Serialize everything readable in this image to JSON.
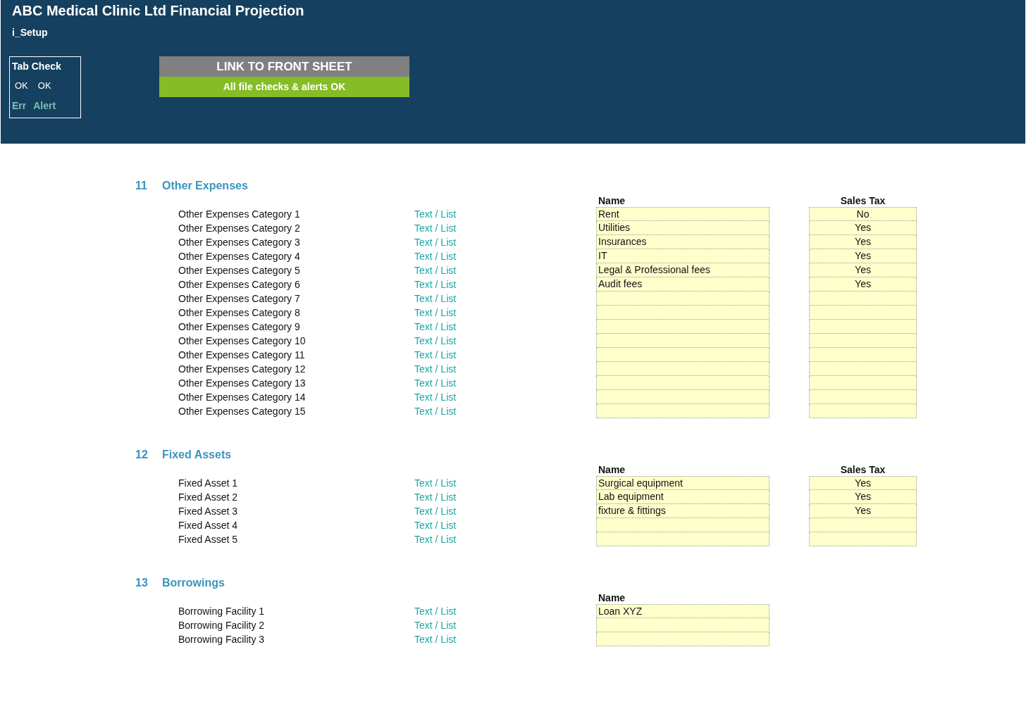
{
  "header": {
    "title": "ABC Medical Clinic Ltd Financial Projection",
    "subtitle": "i_Setup"
  },
  "tab_check": {
    "title": "Tab Check",
    "values": [
      "OK",
      "OK"
    ],
    "labels": [
      "Err",
      "Alert"
    ]
  },
  "link_button": {
    "label": "LINK TO FRONT SHEET"
  },
  "status_banner": {
    "text": "All file checks & alerts OK"
  },
  "sections": [
    {
      "number": "11",
      "title": "Other Expenses",
      "columns": [
        "Name",
        "Sales Tax"
      ],
      "rows": [
        {
          "label": "Other Expenses Category 1",
          "type": "Text / List",
          "name": "Rent",
          "tax": "No"
        },
        {
          "label": "Other Expenses Category 2",
          "type": "Text / List",
          "name": "Utilities",
          "tax": "Yes"
        },
        {
          "label": "Other Expenses Category 3",
          "type": "Text / List",
          "name": "Insurances",
          "tax": "Yes"
        },
        {
          "label": "Other Expenses Category 4",
          "type": "Text / List",
          "name": "IT",
          "tax": "Yes"
        },
        {
          "label": "Other Expenses Category 5",
          "type": "Text / List",
          "name": "Legal & Professional fees",
          "tax": "Yes"
        },
        {
          "label": "Other Expenses Category 6",
          "type": "Text / List",
          "name": "Audit fees",
          "tax": "Yes"
        },
        {
          "label": "Other Expenses Category 7",
          "type": "Text / List"
        },
        {
          "label": "Other Expenses Category 8",
          "type": "Text / List"
        },
        {
          "label": "Other Expenses Category 9",
          "type": "Text / List"
        },
        {
          "label": "Other Expenses Category 10",
          "type": "Text / List"
        },
        {
          "label": "Other Expenses Category 11",
          "type": "Text / List"
        },
        {
          "label": "Other Expenses Category 12",
          "type": "Text / List"
        },
        {
          "label": "Other Expenses Category 13",
          "type": "Text / List"
        },
        {
          "label": "Other Expenses Category 14",
          "type": "Text / List"
        },
        {
          "label": "Other Expenses Category 15",
          "type": "Text / List"
        }
      ]
    },
    {
      "number": "12",
      "title": "Fixed Assets",
      "columns": [
        "Name",
        "Sales Tax"
      ],
      "rows": [
        {
          "label": "Fixed Asset 1",
          "type": "Text / List",
          "name": "Surgical equipment",
          "tax": "Yes"
        },
        {
          "label": "Fixed Asset 2",
          "type": "Text / List",
          "name": "Lab equipment",
          "tax": "Yes"
        },
        {
          "label": "Fixed Asset 3",
          "type": "Text / List",
          "name": "fixture & fittings",
          "tax": "Yes"
        },
        {
          "label": "Fixed Asset 4",
          "type": "Text / List"
        },
        {
          "label": "Fixed Asset 5",
          "type": "Text / List"
        }
      ]
    },
    {
      "number": "13",
      "title": "Borrowings",
      "columns": [
        "Name"
      ],
      "rows": [
        {
          "label": "Borrowing Facility 1",
          "type": "Text / List",
          "name": "Loan XYZ"
        },
        {
          "label": "Borrowing Facility 2",
          "type": "Text / List"
        },
        {
          "label": "Borrowing Facility 3",
          "type": "Text / List"
        }
      ]
    }
  ]
}
